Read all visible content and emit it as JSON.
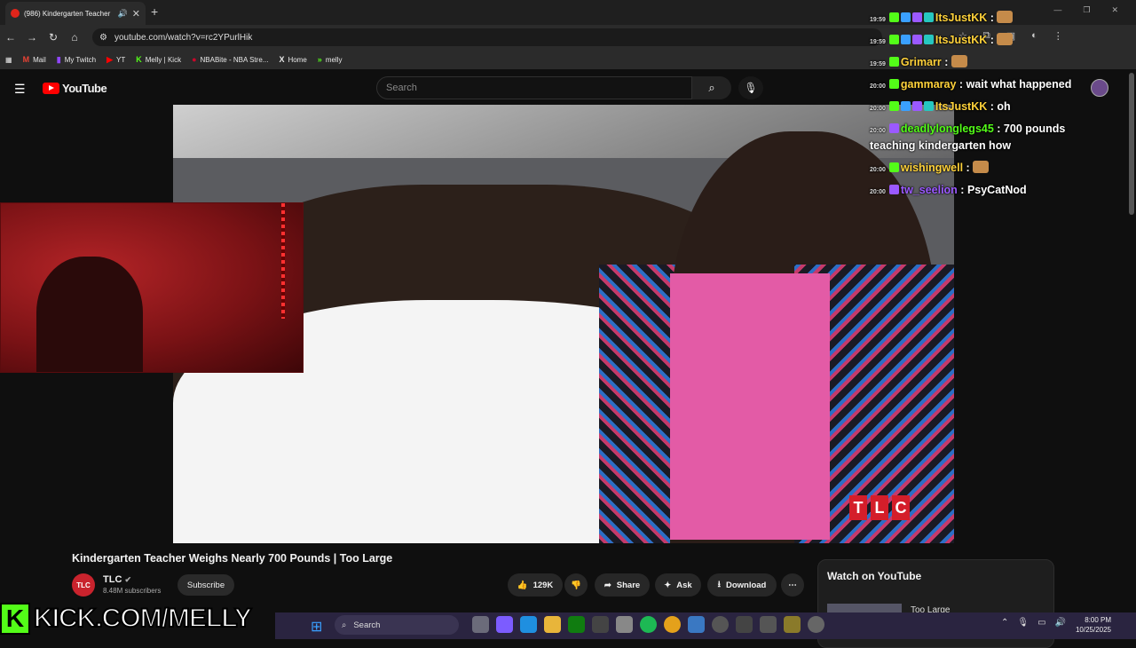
{
  "browser": {
    "tab_title": "(986) Kindergarten Teacher",
    "url": "youtube.com/watch?v=rc2YPurlHik",
    "bookmarks": [
      "Mail",
      "My Twitch",
      "YT",
      "Melly | Kick",
      "NBABite - NBA Stre...",
      "Home",
      "melly"
    ]
  },
  "youtube": {
    "logo": "YouTube",
    "search_placeholder": "Search",
    "video_title": "Kindergarten Teacher Weighs Nearly 700 Pounds | Too Large",
    "channel_name": "TLC",
    "channel_avatar": "TLC",
    "subscribers": "8.48M subscribers",
    "subscribe_label": "Subscribe",
    "likes": "129K",
    "share_label": "Share",
    "ask_label": "Ask",
    "download_label": "Download",
    "watch_on_youtube": "Watch on YouTube",
    "next_title": "Too Large",
    "video_watermark": [
      "T",
      "L",
      "C"
    ]
  },
  "chat": [
    {
      "time": "19:59",
      "user": "ItsJustKK",
      "color": "#ffd23a",
      "message": ""
    },
    {
      "time": "19:59",
      "user": "ItsJustKK",
      "color": "#ffd23a",
      "message": ""
    },
    {
      "time": "19:59",
      "user": "Grimarr",
      "color": "#ffd23a",
      "message": ""
    },
    {
      "time": "20:00",
      "user": "gammaray",
      "color": "#ffd23a",
      "message": "wait what happened"
    },
    {
      "time": "20:00",
      "user": "ItsJustKK",
      "color": "#ffd23a",
      "message": "oh"
    },
    {
      "time": "20:00",
      "user": "deadlylonglegs45",
      "color": "#53fc18",
      "message": "700 pounds"
    },
    {
      "time": "",
      "user": "",
      "color": "#ffffff",
      "message": "teaching kindergarten how"
    },
    {
      "time": "20:00",
      "user": "wishingwell",
      "color": "#ffd23a",
      "message": ""
    },
    {
      "time": "20:00",
      "user": "tw_seelion",
      "color": "#9b59ff",
      "message": "PsyCatNod"
    }
  ],
  "stream": {
    "kick_letter": "K",
    "kick_url": "KICK.COM/MELLY"
  },
  "taskbar": {
    "search": "Search",
    "time": "8:00 PM",
    "date": "10/25/2025"
  }
}
